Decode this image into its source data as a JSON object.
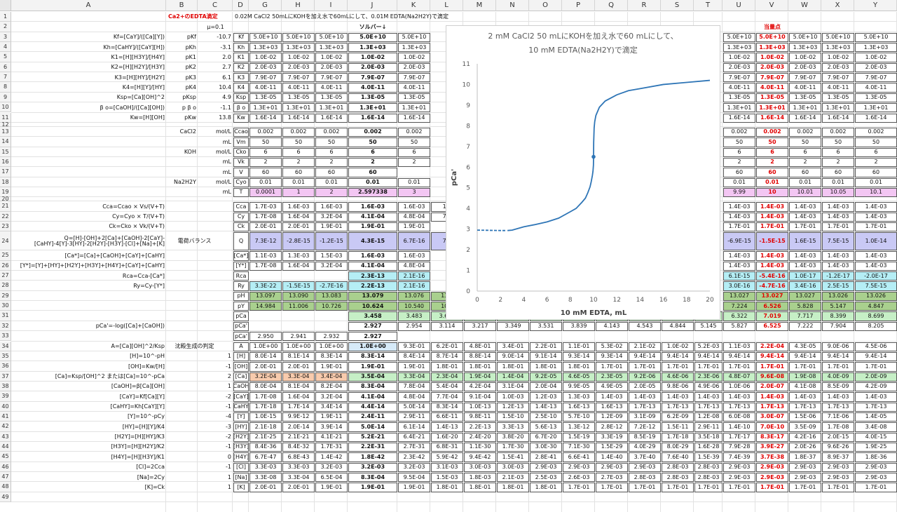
{
  "columns": [
    "A",
    "B",
    "C",
    "D",
    "G",
    "H",
    "I",
    "J",
    "K",
    "L",
    "M",
    "N",
    "O",
    "P",
    "Q",
    "R",
    "S",
    "T",
    "U",
    "V",
    "W",
    "X",
    "Y"
  ],
  "rows": [
    "1",
    "2",
    "3",
    "4",
    "5",
    "6",
    "7",
    "8",
    "9",
    "10",
    "11",
    "12",
    "13",
    "14",
    "15",
    "16",
    "17",
    "18",
    "19",
    "20",
    "21",
    "22",
    "23",
    "24",
    "25",
    "26",
    "27",
    "28",
    "29",
    "30",
    "31",
    "32",
    "33",
    "34",
    "35",
    "36",
    "37",
    "38",
    "39",
    "40",
    "41",
    "42",
    "43",
    "44",
    "45",
    "46",
    "47",
    "48",
    "49"
  ],
  "header_texts": {
    "title": "Ca2+のEDTA滴定",
    "description": "0.02M CaCl2 50mLにKOHを加え水で60mLにして、0.01M EDTA(Na2H2Y)で滴定",
    "mu": "μ=0.1",
    "solver": "ソルバー↓",
    "equivalence": "当量点"
  },
  "colA": {
    "3": "Kf=[CaY]/([Ca][Y])",
    "4": "Kh=[CaHY]/([CaY][H])",
    "5": "K1=[H][H3Y]/[H4Y]",
    "6": "K2=[H][H2Y]/[H3Y]",
    "7": "K3=[H][HY]/[H2Y]",
    "8": "K4=[H][Y]/[HY]",
    "9": "Ksp=[Ca][OH]^2",
    "10": "β o=[CaOH]/([Ca][OH])",
    "11": "Kw=[H][OH]",
    "21": "Cca=Ccao × Vs/(V+T)",
    "22": "Cy=Cyo × T/(V+T)",
    "23": "Ck=Cko × Vk/(V+T)",
    "24": "Q=[H]-[OH]+2[Ca]+[CaOH]-2[CaY]-[CaHY]-4[Y]-3[HY]-2[H2Y]-[H3Y]-[Cl]+[Na]+[K]",
    "25": "[Ca*]=[Ca]+[CaOH]+[CaY]+[CaHY]",
    "26": "[Y*]=[Y]+[HY]+[H2Y]+[H3Y]+[H4Y]+[CaY]+[CaHY]",
    "27": "Rca=Cca-[Ca*]",
    "28": "Ry=Cy-[Y*]",
    "32": "pCa'=-log([Ca]+[CaOH])",
    "34": "A=[Ca][OH]^2/Ksp",
    "35": "[H]=10^-pH",
    "36": "[OH]=Kw/[H]",
    "37": "[Ca]=Ksp/[OH]^2 または[Ca]=10^-pCa",
    "38": "[CaOH]=β[Ca][OH]",
    "39": "[CaY]=Kf[Ca][Y]",
    "40": "[CaHY]=Kh[CaY][Y]",
    "41": "[Y]=10^-pCy",
    "42": "[HY]=[H][Y]/K4",
    "43": "[H2Y]=[H][HY]/K3",
    "44": "[H3Y]=[H][H2Y]/K2",
    "45": "[H4Y]=[H][H3Y]/K1",
    "46": "[Cl]=2Cca",
    "47": "[Na]=2Cy",
    "48": "[K]=Ck"
  },
  "colB": {
    "3": "pKf",
    "4": "pKh",
    "5": "pK1",
    "6": "pK2",
    "7": "pK3",
    "8": "pK4",
    "9": "pKsp",
    "10": "p β o",
    "11": "pKw",
    "13": "CaCl2",
    "15": "KOH",
    "18": "Na2H2Y",
    "24": "電荷バランス",
    "34": "沈殿生成の判定"
  },
  "colC": {
    "3": "-10.7",
    "4": "-3.1",
    "5": "2.0",
    "6": "2.7",
    "7": "6.1",
    "8": "10.4",
    "9": "4.9",
    "10": "-1.1",
    "11": "13.8",
    "13": "mol/L",
    "14": "mL",
    "15": "mol/L",
    "16": "mL",
    "17": "mL",
    "18": "mol/L",
    "19": "mL",
    "35": "1",
    "36": "-1",
    "37": "2",
    "38": "1",
    "39": "-2",
    "40": "-1",
    "41": "-4",
    "42": "-3",
    "43": "-2",
    "44": "-1",
    "45": "0",
    "46": "-1",
    "47": "1",
    "48": "1"
  },
  "colD": {
    "3": "Kf",
    "4": "Kh",
    "5": "K1",
    "6": "K2",
    "7": "K3",
    "8": "K4",
    "9": "Ksp",
    "10": "β o",
    "11": "Kw",
    "13": "Ccao",
    "14": "Vm",
    "15": "Cko",
    "16": "Vk",
    "17": "V",
    "18": "Cyo",
    "19": "T",
    "21": "Cca",
    "22": "Cy",
    "23": "Ck",
    "24": "Q",
    "25": "[Ca*]",
    "26": "[Y*]",
    "27": "Rca",
    "28": "Ry",
    "29": "pH",
    "30": "pY",
    "31": "pCa",
    "32": "pCa'",
    "33": "pCa'",
    "34": "A",
    "35": "[H]",
    "36": "[OH]",
    "37": "[Ca]",
    "38": "[CaOH]",
    "39": "[CaY]",
    "40": "[CaHY]",
    "41": "[Y]",
    "42": "[HY]",
    "43": "[H2Y]",
    "44": "[H3Y]",
    "45": "[H4Y]",
    "46": "[Cl]",
    "47": "[Na]",
    "48": "[K]"
  },
  "data_cols": {
    "G": {
      "3": "5.0E+10",
      "4": "1.3E+03",
      "5": "1.0E-02",
      "6": "2.0E-03",
      "7": "7.9E-07",
      "8": "4.0E-11",
      "9": "1.3E-05",
      "10": "1.3E+01",
      "11": "1.6E-14",
      "13": "0.002",
      "14": "50",
      "15": "6",
      "16": "2",
      "17": "60",
      "18": "0.01",
      "19": "0.0001",
      "21": "1.7E-03",
      "22": "1.7E-08",
      "23": "2.0E-01",
      "24": "7.3E-12",
      "25": "1.1E-03",
      "26": "1.7E-08",
      "28": "3.3E-22",
      "29": "13.097",
      "30": "14.984",
      "33": "2.950",
      "34": "1.0E+00",
      "35": "8.0E-14",
      "36": "2.0E-01",
      "37": "3.2E-04",
      "38": "8.0E-04",
      "39": "1.7E-08",
      "40": "1.7E-18",
      "41": "1.0E-15",
      "42": "2.1E-18",
      "43": "2.1E-25",
      "44": "8.4E-36",
      "45": "6.7E-47",
      "46": "3.3E-03",
      "47": "3.3E-08",
      "48": "2.0E-01"
    },
    "H": {
      "3": "5.0E+10",
      "4": "1.3E+03",
      "5": "1.0E-02",
      "6": "2.0E-03",
      "7": "7.9E-07",
      "8": "4.0E-11",
      "9": "1.3E-05",
      "10": "1.3E+01",
      "11": "1.6E-14",
      "13": "0.002",
      "14": "50",
      "15": "6",
      "16": "2",
      "17": "60",
      "18": "0.01",
      "19": "1",
      "21": "1.6E-03",
      "22": "1.6E-04",
      "23": "2.0E-01",
      "24": "-2.8E-15",
      "25": "1.3E-03",
      "26": "1.6E-04",
      "28": "-1.5E-15",
      "29": "13.090",
      "30": "11.006",
      "33": "2.941",
      "34": "1.0E+00",
      "35": "8.1E-14",
      "36": "2.0E-01",
      "37": "3.3E-04",
      "38": "8.1E-04",
      "39": "1.6E-04",
      "40": "1.7E-14",
      "41": "9.9E-12",
      "42": "2.0E-14",
      "43": "2.1E-21",
      "44": "8.4E-32",
      "45": "6.8E-43",
      "46": "3.3E-03",
      "47": "3.3E-04",
      "48": "2.0E-01"
    },
    "I": {
      "3": "5.0E+10",
      "4": "1.3E+03",
      "5": "1.0E-02",
      "6": "2.0E-03",
      "7": "7.9E-07",
      "8": "4.0E-11",
      "9": "1.3E-05",
      "10": "1.3E+01",
      "11": "1.6E-14",
      "13": "0.002",
      "14": "50",
      "15": "6",
      "16": "2",
      "17": "60",
      "18": "0.01",
      "19": "2",
      "21": "1.6E-03",
      "22": "3.2E-04",
      "23": "1.9E-01",
      "24": "-1.2E-15",
      "25": "1.5E-03",
      "26": "3.2E-04",
      "28": "-2.7E-16",
      "29": "13.083",
      "30": "10.726",
      "33": "2.932",
      "34": "1.0E+00",
      "35": "8.3E-14",
      "36": "1.9E-01",
      "37": "3.4E-04",
      "38": "8.2E-04",
      "39": "3.2E-04",
      "40": "3.4E-14",
      "41": "1.9E-11",
      "42": "3.9E-14",
      "43": "4.1E-21",
      "44": "1.7E-31",
      "45": "1.4E-42",
      "46": "3.2E-03",
      "47": "6.5E-04",
      "48": "1.9E-01"
    },
    "J": {
      "3": "5.0E+10",
      "4": "1.3E+03",
      "5": "1.0E-02",
      "6": "2.0E-03",
      "7": "7.9E-07",
      "8": "4.0E-11",
      "9": "1.3E-05",
      "10": "1.3E+01",
      "11": "1.6E-14",
      "13": "0.002",
      "14": "50",
      "15": "6",
      "16": "2",
      "17": "60",
      "18": "0.01",
      "19": "2.597338",
      "21": "1.6E-03",
      "22": "4.1E-04",
      "23": "1.9E-01",
      "24": "4.3E-15",
      "25": "1.6E-03",
      "26": "4.1E-04",
      "27": "2.3E-13",
      "28": "2.2E-13",
      "29": "13.079",
      "30": "10.624",
      "31": "3.458",
      "32": "2.927",
      "33": "2.927",
      "34": "1.0E+00",
      "35": "8.3E-14",
      "36": "1.9E-01",
      "37": "3.5E-04",
      "38": "8.3E-04",
      "39": "4.1E-04",
      "40": "4.4E-14",
      "41": "2.4E-11",
      "42": "5.0E-14",
      "43": "5.2E-21",
      "44": "2.2E-31",
      "45": "1.8E-42",
      "46": "3.2E-03",
      "47": "8.3E-04",
      "48": "1.9E-01"
    },
    "K": {
      "3": "5.0E+10",
      "4": "1.3E+03",
      "5": "1.0E-02",
      "6": "2.0E-03",
      "7": "7.9E-07",
      "8": "4.0E-11",
      "9": "1.3E-05",
      "10": "1.3E+01",
      "11": "1.6E-14",
      "13": "0.002",
      "14": "50",
      "15": "6",
      "16": "2",
      "18": "0.01",
      "19": "3",
      "21": "1.6E-03",
      "22": "4.8E-04",
      "23": "1.9E-01",
      "24": "6.7E-16",
      "25": "1.6E-03",
      "26": "4.8E-04",
      "27": "2.1E-16",
      "28": "2.1E-16",
      "29": "13.076",
      "30": "10.540",
      "31": "3.483",
      "32": "2.954",
      "34": "9.3E-01",
      "35": "8.4E-14",
      "36": "1.9E-01",
      "37": "3.3E-04",
      "38": "7.8E-04",
      "39": "4.8E-04",
      "40": "5.0E-14",
      "41": "2.9E-11",
      "42": "6.1E-14",
      "43": "6.4E-21",
      "44": "2.7E-31",
      "45": "2.3E-42",
      "46": "3.2E-03",
      "47": "9.5E-04",
      "48": "1.9E-01"
    },
    "L": {
      "21": "1.5",
      "22": "7.7",
      "24": "7.8",
      "29": "13.0",
      "30": "10.4",
      "31": "3.632",
      "32": "3.114",
      "34": "6.2E-01",
      "35": "8.7E-14",
      "36": "1.8E-01",
      "37": "2.3E-04",
      "38": "5.4E-04",
      "39": "7.7E-04",
      "40": "8.3E-14",
      "41": "6.6E-11",
      "42": "1.4E-13",
      "43": "1.6E-20",
      "44": "6.8E-31",
      "45": "5.9E-42",
      "46": "3.1E-03",
      "47": "1.5E-03",
      "48": "1.8E-01"
    },
    "M": {
      "31": "3.731",
      "32": "3.217",
      "34": "4.8E-01",
      "35": "8.8E-14",
      "36": "1.8E-01",
      "37": "1.9E-04",
      "38": "4.2E-04",
      "39": "9.1E-04",
      "40": "1.0E-13",
      "41": "9.8E-11",
      "42": "2.2E-13",
      "43": "2.4E-20",
      "44": "1.1E-30",
      "45": "9.4E-42",
      "46": "3.0E-03",
      "47": "1.8E-03",
      "48": "1.8E-01"
    },
    "N": {
      "31": "3.857",
      "32": "3.349",
      "34": "3.4E-01",
      "35": "9.0E-14",
      "36": "1.8E-01",
      "37": "1.4E-04",
      "38": "3.1E-04",
      "39": "1.0E-03",
      "40": "1.2E-13",
      "41": "1.5E-10",
      "42": "3.3E-13",
      "43": "3.8E-20",
      "44": "1.7E-30",
      "45": "1.5E-41",
      "46": "3.0E-03",
      "47": "2.1E-03",
      "48": "1.8E-01"
    },
    "O": {
      "31": "4.035",
      "32": "3.531",
      "34": "2.2E-01",
      "35": "9.1E-14",
      "36": "1.8E-01",
      "37": "9.2E-05",
      "38": "2.0E-04",
      "39": "1.2E-03",
      "40": "1.4E-13",
      "41": "2.5E-10",
      "42": "5.6E-13",
      "43": "6.7E-20",
      "44": "3.0E-30",
      "45": "2.8E-41",
      "46": "2.9E-03",
      "47": "2.5E-03",
      "48": "1.8E-01"
    },
    "P": {
      "31": "4.338",
      "32": "3.839",
      "34": "1.1E-01",
      "35": "9.3E-14",
      "36": "1.8E-01",
      "37": "4.6E-05",
      "38": "9.9E-05",
      "39": "1.3E-03",
      "40": "1.6E-13",
      "41": "5.7E-10",
      "42": "1.3E-12",
      "43": "1.5E-19",
      "44": "7.1E-30",
      "45": "6.6E-41",
      "46": "2.9E-03",
      "47": "2.6E-03",
      "48": "1.7E-01"
    },
    "Q": {
      "31": "4.640",
      "32": "4.143",
      "34": "5.3E-02",
      "35": "9.3E-14",
      "36": "1.7E-01",
      "37": "2.3E-05",
      "38": "4.9E-05",
      "39": "1.4E-03",
      "40": "1.6E-13",
      "41": "1.2E-09",
      "42": "2.8E-12",
      "43": "3.3E-19",
      "44": "1.5E-29",
      "45": "1.4E-40",
      "46": "2.9E-03",
      "47": "2.7E-03",
      "48": "1.7E-01"
    },
    "R": {
      "31": "5.038",
      "32": "4.543",
      "34": "2.1E-02",
      "35": "9.4E-14",
      "36": "1.7E-01",
      "37": "9.2E-06",
      "38": "2.0E-05",
      "39": "1.4E-03",
      "40": "1.7E-13",
      "41": "3.1E-09",
      "42": "7.2E-12",
      "43": "8.5E-19",
      "44": "4.0E-29",
      "45": "3.7E-40",
      "46": "2.9E-03",
      "47": "2.8E-03",
      "48": "1.7E-01"
    },
    "S": {
      "31": "5.339",
      "32": "4.844",
      "34": "1.0E-02",
      "35": "9.4E-14",
      "36": "1.7E-01",
      "37": "4.6E-06",
      "38": "9.8E-06",
      "39": "1.4E-03",
      "40": "1.7E-13",
      "41": "6.2E-09",
      "42": "1.5E-11",
      "43": "1.7E-18",
      "44": "8.0E-29",
      "45": "7.6E-40",
      "46": "2.8E-03",
      "47": "2.8E-03",
      "48": "1.7E-01"
    },
    "T": {
      "31": "5.640",
      "32": "5.145",
      "34": "5.2E-03",
      "35": "9.4E-14",
      "36": "1.7E-01",
      "37": "2.3E-06",
      "38": "4.9E-06",
      "39": "1.4E-03",
      "40": "1.7E-13",
      "41": "1.2E-08",
      "42": "2.9E-11",
      "43": "3.5E-18",
      "44": "1.6E-28",
      "45": "1.5E-39",
      "46": "2.8E-03",
      "47": "2.8E-03",
      "48": "1.7E-01"
    },
    "U": {
      "3": "5.0E+10",
      "4": "1.3E+03",
      "5": "1.0E-02",
      "6": "2.0E-03",
      "7": "7.9E-07",
      "8": "4.0E-11",
      "9": "1.3E-05",
      "10": "1.3E+01",
      "11": "1.6E-14",
      "13": "0.002",
      "14": "50",
      "15": "6",
      "16": "2",
      "17": "60",
      "18": "0.01",
      "19": "9.99",
      "21": "1.4E-03",
      "22": "1.4E-03",
      "23": "1.7E-01",
      "24": "-6.9E-15",
      "25": "1.4E-03",
      "26": "1.4E-03",
      "27": "6.1E-15",
      "28": "3.0E-16",
      "29": "13.027",
      "30": "7.224",
      "31": "6.322",
      "32": "5.827",
      "34": "1.1E-03",
      "35": "9.4E-14",
      "36": "1.7E-01",
      "37": "4.8E-07",
      "38": "1.0E-06",
      "39": "1.4E-03",
      "40": "1.7E-13",
      "41": "6.0E-08",
      "42": "1.4E-10",
      "43": "1.7E-17",
      "44": "7.9E-28",
      "45": "7.4E-39",
      "46": "2.9E-03",
      "47": "2.9E-03",
      "48": "1.7E-01"
    },
    "V": {
      "3": "5.0E+10",
      "4": "1.3E+03",
      "5": "1.0E-02",
      "6": "2.0E-03",
      "7": "7.9E-07",
      "8": "4.0E-11",
      "9": "1.3E-05",
      "10": "1.3E+01",
      "11": "1.6E-14",
      "13": "0.002",
      "14": "50",
      "15": "6",
      "16": "2",
      "17": "60",
      "18": "0.01",
      "19": "10",
      "21": "1.4E-03",
      "22": "1.4E-03",
      "23": "1.7E-01",
      "24": "-1.5E-15",
      "25": "1.4E-03",
      "26": "1.4E-03",
      "27": "-5.4E-16",
      "28": "-4.7E-16",
      "29": "13.027",
      "30": "6.526",
      "31": "7.019",
      "32": "6.525",
      "34": "2.2E-04",
      "35": "9.4E-14",
      "36": "1.7E-01",
      "37": "9.6E-08",
      "38": "2.0E-07",
      "39": "1.4E-03",
      "40": "1.7E-13",
      "41": "3.0E-07",
      "42": "7.0E-10",
      "43": "8.3E-17",
      "44": "3.9E-27",
      "45": "3.7E-38",
      "46": "2.9E-03",
      "47": "2.9E-03",
      "48": "1.7E-01"
    },
    "W": {
      "3": "5.0E+10",
      "4": "1.3E+03",
      "5": "1.0E-02",
      "6": "2.0E-03",
      "7": "7.9E-07",
      "8": "4.0E-11",
      "9": "1.3E-05",
      "10": "1.3E+01",
      "11": "1.6E-14",
      "13": "0.002",
      "14": "50",
      "15": "6",
      "16": "2",
      "17": "60",
      "18": "0.01",
      "19": "10.01",
      "21": "1.4E-03",
      "22": "1.4E-03",
      "23": "1.7E-01",
      "24": "1.6E-15",
      "25": "1.4E-03",
      "26": "1.4E-03",
      "27": "1.0E-17",
      "28": "3.4E-16",
      "29": "13.027",
      "30": "5.828",
      "31": "7.717",
      "32": "7.222",
      "34": "4.3E-05",
      "35": "9.4E-14",
      "36": "1.7E-01",
      "37": "1.9E-08",
      "38": "4.1E-08",
      "39": "1.4E-03",
      "40": "1.7E-13",
      "41": "1.5E-06",
      "42": "3.5E-09",
      "43": "4.2E-16",
      "44": "2.0E-26",
      "45": "1.8E-37",
      "46": "2.9E-03",
      "47": "2.9E-03",
      "48": "1.7E-01"
    },
    "X": {
      "3": "5.0E+10",
      "4": "1.3E+03",
      "5": "1.0E-02",
      "6": "2.0E-03",
      "7": "7.9E-07",
      "8": "4.0E-11",
      "9": "1.3E-05",
      "10": "1.3E+01",
      "11": "1.6E-14",
      "13": "0.002",
      "14": "50",
      "15": "6",
      "16": "2",
      "17": "60",
      "18": "0.01",
      "19": "10.05",
      "21": "1.4E-03",
      "22": "1.4E-03",
      "23": "1.7E-01",
      "24": "7.5E-15",
      "25": "1.4E-03",
      "26": "1.4E-03",
      "27": "-1.2E-17",
      "28": "2.5E-15",
      "29": "13.026",
      "30": "5.147",
      "31": "8.399",
      "32": "7.904",
      "34": "9.0E-06",
      "35": "9.4E-14",
      "36": "1.7E-01",
      "37": "4.0E-09",
      "38": "8.5E-09",
      "39": "1.4E-03",
      "40": "1.7E-13",
      "41": "7.1E-06",
      "42": "1.7E-08",
      "43": "2.0E-15",
      "44": "9.6E-26",
      "45": "8.9E-37",
      "46": "2.9E-03",
      "47": "2.9E-03",
      "48": "1.7E-01"
    },
    "Y": {
      "3": "5.0E+10",
      "4": "1.3E+03",
      "5": "1.0E-02",
      "6": "2.0E-03",
      "7": "7.9E-07",
      "8": "4.0E-11",
      "9": "1.3E-05",
      "10": "1.3E+01",
      "11": "1.6E-14",
      "13": "0.002",
      "14": "50",
      "15": "6",
      "16": "2",
      "17": "60",
      "18": "0.01",
      "19": "10.1",
      "21": "1.4E-03",
      "22": "1.4E-03",
      "23": "1.7E-01",
      "24": "1.0E-14",
      "25": "1.4E-03",
      "26": "1.4E-03",
      "27": "-2.0E-17",
      "28": "7.5E-15",
      "29": "13.026",
      "30": "4.847",
      "31": "8.699",
      "32": "8.205",
      "34": "4.5E-06",
      "35": "9.4E-14",
      "36": "1.7E-01",
      "37": "2.0E-09",
      "38": "4.2E-09",
      "39": "1.4E-03",
      "40": "1.7E-13",
      "41": "1.4E-05",
      "42": "3.4E-08",
      "43": "4.0E-15",
      "44": "1.9E-25",
      "45": "1.8E-36",
      "46": "2.9E-03",
      "47": "2.9E-03",
      "48": "1.7E-01"
    }
  },
  "colors": {
    "yellow": "#fff2a8",
    "pink": "#f3c6f3",
    "lightgreen": "#c6efc6",
    "darkgreen": "#a9d08e",
    "lavender": "#c9c9f5",
    "cyan": "#b5eef5",
    "lightblue": "#d6eaf8",
    "orange": "#f8cbad",
    "red": "#e00000",
    "curve": "#2e75b6"
  },
  "chart_data": {
    "type": "line",
    "title": "2 mM CaCl2 50 mLにKOHを加え水で60 mLにして、",
    "subtitle": "10 mM EDTA(Na2H2Y)で滴定",
    "xlabel": "10 mM EDTA, mL",
    "ylabel": "pCa'",
    "xlim": [
      0,
      20
    ],
    "ylim": [
      0,
      11
    ],
    "xticks": [
      "0",
      "2",
      "4",
      "6",
      "8",
      "10",
      "12",
      "14",
      "16",
      "18",
      "20"
    ],
    "yticks": [
      "0",
      "1",
      "2",
      "3",
      "4",
      "5",
      "6",
      "7",
      "8",
      "9",
      "10",
      "11"
    ],
    "grid": false,
    "series": [
      {
        "style": "dashed",
        "x": [
          0,
          1,
          2,
          2.5
        ],
        "y": [
          2.95,
          2.94,
          2.93,
          2.93
        ]
      },
      {
        "style": "solid",
        "x": [
          2.6,
          3,
          4,
          5,
          6,
          7,
          8,
          8.5,
          9,
          9.3,
          9.5,
          9.7,
          9.8,
          9.9,
          9.95,
          9.99,
          10,
          10.01,
          10.05,
          10.1,
          10.2,
          10.5,
          11,
          12,
          13,
          14,
          16,
          18,
          20
        ],
        "y": [
          2.93,
          2.95,
          3.11,
          3.22,
          3.35,
          3.53,
          3.84,
          4.0,
          4.3,
          4.5,
          4.75,
          5.05,
          5.3,
          5.6,
          5.8,
          6.1,
          6.5,
          7.2,
          7.9,
          8.2,
          8.5,
          8.9,
          9.2,
          9.5,
          9.7,
          9.8,
          10.0,
          10.1,
          10.2
        ]
      }
    ],
    "markers": [
      {
        "x": 10,
        "y": 6.5
      }
    ]
  }
}
